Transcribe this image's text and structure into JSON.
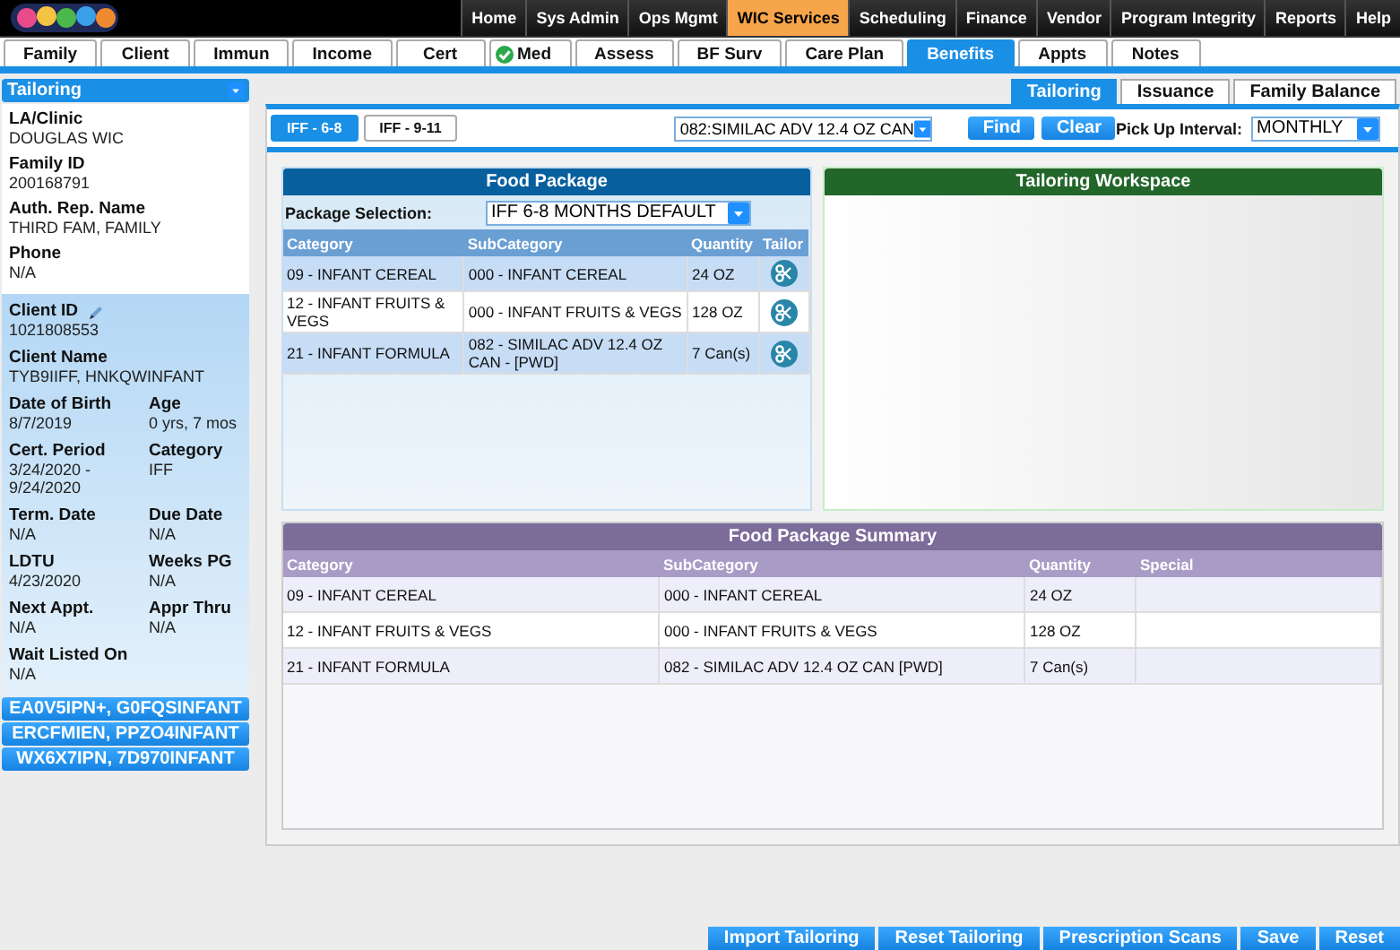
{
  "top_menu": [
    {
      "label": "Home",
      "selected": false
    },
    {
      "label": "Sys Admin",
      "selected": false
    },
    {
      "label": "Ops Mgmt",
      "selected": false
    },
    {
      "label": "WIC Services",
      "selected": true
    },
    {
      "label": "Scheduling",
      "selected": false
    },
    {
      "label": "Finance",
      "selected": false
    },
    {
      "label": "Vendor",
      "selected": false
    },
    {
      "label": "Program Integrity",
      "selected": false
    },
    {
      "label": "Reports",
      "selected": false
    },
    {
      "label": "Help",
      "selected": false
    }
  ],
  "tabs": [
    {
      "label": "Family",
      "selected": false,
      "checked": false
    },
    {
      "label": "Client",
      "selected": false,
      "checked": false
    },
    {
      "label": "Immun",
      "selected": false,
      "checked": false
    },
    {
      "label": "Income",
      "selected": false,
      "checked": false
    },
    {
      "label": "Cert",
      "selected": false,
      "checked": false
    },
    {
      "label": "Med",
      "selected": false,
      "checked": true
    },
    {
      "label": "Assess",
      "selected": false,
      "checked": false
    },
    {
      "label": "BF Surv",
      "selected": false,
      "checked": false
    },
    {
      "label": "Care Plan",
      "selected": false,
      "checked": false
    },
    {
      "label": "Benefits",
      "selected": true,
      "checked": false
    },
    {
      "label": "Appts",
      "selected": false,
      "checked": false
    },
    {
      "label": "Notes",
      "selected": false,
      "checked": false
    }
  ],
  "sidebar": {
    "dropdown": "Tailoring",
    "family_fields": [
      {
        "label": "LA/Clinic",
        "value": "DOUGLAS WIC"
      },
      {
        "label": "Family ID",
        "value": "200168791"
      },
      {
        "label": "Auth. Rep. Name",
        "value": "THIRD FAM, FAMILY"
      },
      {
        "label": "Phone",
        "value": "N/A"
      }
    ],
    "client_fields": [
      {
        "label": "Client ID",
        "value": "1021808553",
        "kind": "editable"
      },
      {
        "label": "Client Name",
        "value": "TYB9IIFF, HNKQWINFANT",
        "kind": "full"
      },
      {
        "label": "Date of Birth",
        "value": "8/7/2019",
        "kind": "half"
      },
      {
        "label": "Age",
        "value": "0 yrs, 7 mos",
        "kind": "half"
      },
      {
        "label": "Cert. Period",
        "value": "3/24/2020 - 9/24/2020",
        "kind": "half"
      },
      {
        "label": "Category",
        "value": "IFF",
        "kind": "half"
      },
      {
        "label": "Term. Date",
        "value": "N/A",
        "kind": "half"
      },
      {
        "label": "Due Date",
        "value": "N/A",
        "kind": "half"
      },
      {
        "label": "LDTU",
        "value": "4/23/2020",
        "kind": "half"
      },
      {
        "label": "Weeks PG",
        "value": "N/A",
        "kind": "half"
      },
      {
        "label": "Next Appt.",
        "value": "N/A",
        "kind": "half"
      },
      {
        "label": "Appr Thru",
        "value": "N/A",
        "kind": "half"
      },
      {
        "label": "Wait Listed On",
        "value": "N/A",
        "kind": "full"
      }
    ],
    "family_members": [
      "EA0V5IPN+, G0FQSINFANT",
      "ERCFMIEN, PPZO4INFANT",
      "WX6X7IPN, 7D970INFANT"
    ]
  },
  "sub_tabs": [
    {
      "label": "Tailoring",
      "selected": true
    },
    {
      "label": "Issuance",
      "selected": false
    },
    {
      "label": "Family Balance",
      "selected": false
    }
  ],
  "toolbar": {
    "package_tabs": [
      {
        "label": "IFF - 6-8",
        "selected": true
      },
      {
        "label": "IFF - 9-11",
        "selected": false
      }
    ],
    "product_select": "082:SIMILAC ADV 12.4 OZ CAN",
    "buttons": [
      "Find",
      "Clear"
    ],
    "pickup_label": "Pick Up Interval:",
    "pickup_value": "MONTHLY"
  },
  "food_package": {
    "title": "Food Package",
    "selection_label": "Package Selection:",
    "selection_value": "IFF 6-8 MONTHS DEFAULT",
    "columns": [
      "Category",
      "SubCategory",
      "Quantity",
      "Tailor"
    ],
    "rows": [
      [
        "09 - INFANT CEREAL",
        "000 - INFANT CEREAL",
        "24 OZ"
      ],
      [
        "12 - INFANT FRUITS & VEGS",
        "000 - INFANT FRUITS & VEGS",
        "128 OZ"
      ],
      [
        "21 - INFANT FORMULA",
        "082 - SIMILAC ADV 12.4 OZ CAN - [PWD]",
        "7 Can(s)"
      ]
    ]
  },
  "workspace": {
    "title": "Tailoring Workspace"
  },
  "summary": {
    "title": "Food Package Summary",
    "columns": [
      "Category",
      "SubCategory",
      "Quantity",
      "Special"
    ],
    "rows": [
      [
        "09 - INFANT CEREAL",
        "000 - INFANT CEREAL",
        "24 OZ"
      ],
      [
        "12 - INFANT FRUITS & VEGS",
        "000 - INFANT FRUITS & VEGS",
        "128 OZ"
      ],
      [
        "21 - INFANT FORMULA",
        "082 - SIMILAC ADV 12.4 OZ CAN [PWD]",
        "7 Can(s)"
      ]
    ]
  },
  "footer_buttons": [
    "Import Tailoring",
    "Reset Tailoring",
    "Prescription Scans",
    "Save",
    "Reset"
  ]
}
